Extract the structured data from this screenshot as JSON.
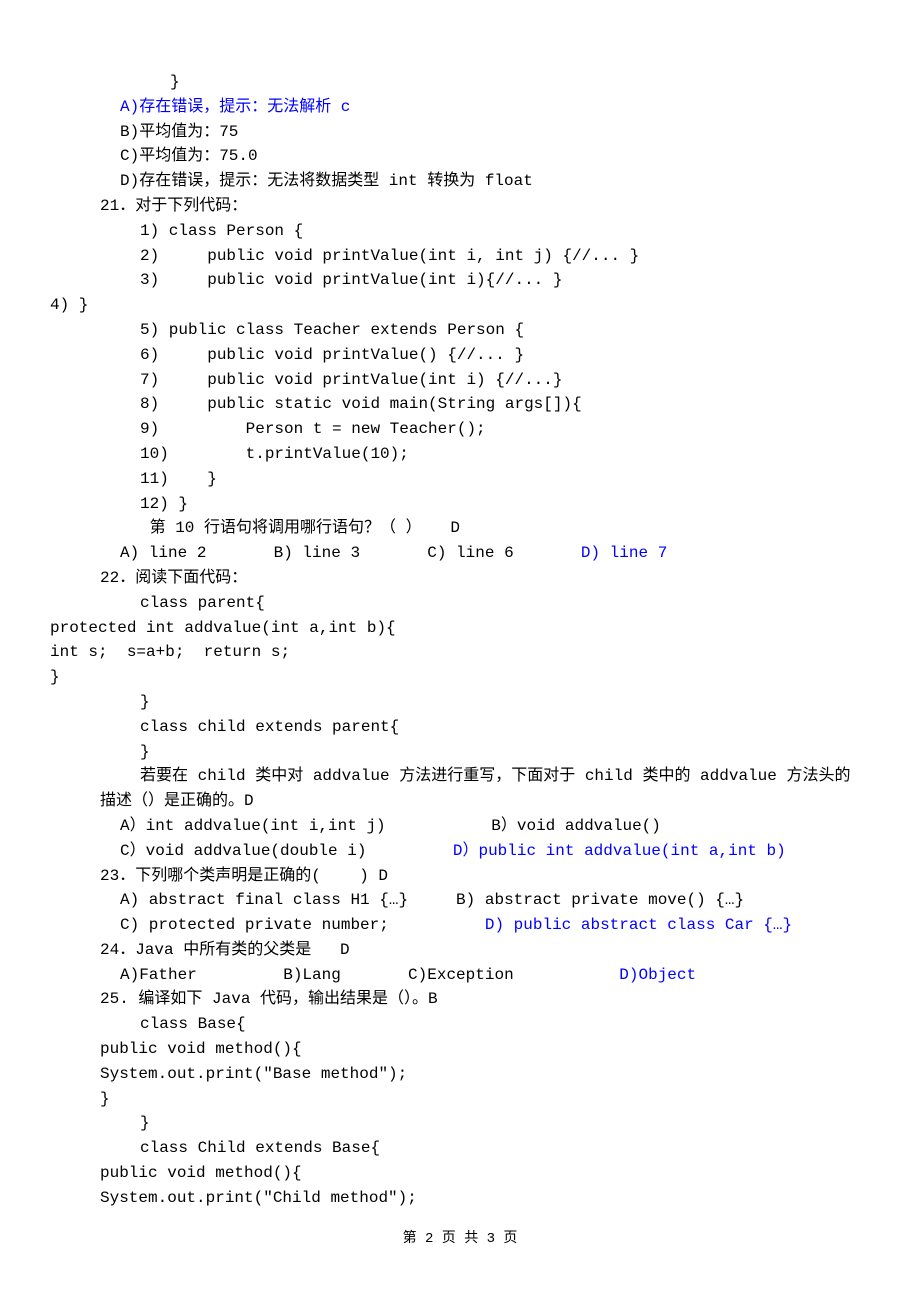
{
  "lines": [
    {
      "cls": "ind4",
      "text": "}"
    },
    {
      "cls": "ind2 blue",
      "text": "A)存在错误，提示：无法解析 c"
    },
    {
      "cls": "ind2",
      "text": "B)平均值为：75"
    },
    {
      "cls": "ind2",
      "text": "C)平均值为：75.0"
    },
    {
      "cls": "ind2",
      "text": "D)存在错误，提示：无法将数据类型 int 转换为 float"
    },
    {
      "cls": "ind1",
      "text": "21．对于下列代码："
    },
    {
      "cls": "ind3",
      "text": "1) class Person {"
    },
    {
      "cls": "ind3",
      "text": "2)     public void printValue(int i, int j) {//... }"
    },
    {
      "cls": "ind3",
      "text": "3)     public void printValue(int i){//... }"
    },
    {
      "cls": "no-ind",
      "text": "4) }"
    },
    {
      "cls": "ind3",
      "text": "5) public class Teacher extends Person {"
    },
    {
      "cls": "ind3",
      "text": "6)     public void printValue() {//... }"
    },
    {
      "cls": "ind3",
      "text": "7)     public void printValue(int i) {//...}"
    },
    {
      "cls": "ind3",
      "text": "8)     public static void main(String args[]){"
    },
    {
      "cls": "ind3",
      "text": "9)         Person t = new Teacher();"
    },
    {
      "cls": "ind3",
      "text": "10)        t.printValue(10);"
    },
    {
      "cls": "ind3",
      "text": "11)    }"
    },
    {
      "cls": "ind3",
      "text": "12) }"
    },
    {
      "cls": "ind3",
      "text": " 第 10 行语句将调用哪行语句？（ ）   D"
    },
    {
      "cls": "ind2",
      "parts": [
        {
          "text": "A) line 2       B) line 3       C) line 6       "
        },
        {
          "text": "D) line 7",
          "blue": true
        }
      ]
    },
    {
      "cls": "ind1",
      "text": "22．阅读下面代码："
    },
    {
      "cls": "ind3",
      "text": "class parent{"
    },
    {
      "cls": "no-ind",
      "text": "protected int addvalue(int a,int b){"
    },
    {
      "cls": "no-ind",
      "text": "int s;  s=a+b;  return s;"
    },
    {
      "cls": "no-ind",
      "text": "}"
    },
    {
      "cls": "ind3",
      "text": "}"
    },
    {
      "cls": "ind3",
      "text": "class child extends parent{"
    },
    {
      "cls": "ind3",
      "text": "}"
    },
    {
      "cls": "ind3",
      "text": "若要在 child 类中对 addvalue 方法进行重写，下面对于 child 类中的 addvalue 方法头的"
    },
    {
      "cls": "ind1",
      "text": "描述（）是正确的。D"
    },
    {
      "cls": "ind2",
      "text": "A）int addvalue(int i,int j)           B）void addvalue()"
    },
    {
      "cls": "ind2",
      "parts": [
        {
          "text": "C）void addvalue(double i)         "
        },
        {
          "text": "D）public int addvalue(int a,int b)",
          "blue": true
        }
      ]
    },
    {
      "cls": "ind1",
      "text": "23．下列哪个类声明是正确的(    ) D"
    },
    {
      "cls": "ind2",
      "text": "A) abstract final class H1 {…}     B) abstract private move() {…}"
    },
    {
      "cls": "ind2",
      "parts": [
        {
          "text": "C) protected private number;          "
        },
        {
          "text": "D) public abstract class Car {…}",
          "blue": true
        }
      ]
    },
    {
      "cls": "ind1",
      "text": "24．Java 中所有类的父类是   D"
    },
    {
      "cls": "ind2",
      "parts": [
        {
          "text": "A)Father         B)Lang       C)Exception           "
        },
        {
          "text": "D)Object",
          "blue": true
        }
      ]
    },
    {
      "cls": "ind1",
      "text": "25. 编译如下 Java 代码，输出结果是（）。B"
    },
    {
      "cls": "ind3",
      "text": "class Base{"
    },
    {
      "cls": "ind1",
      "text": "public void method(){"
    },
    {
      "cls": "ind1",
      "text": "System.out.print(\"Base method\");"
    },
    {
      "cls": "ind1",
      "text": "}"
    },
    {
      "cls": "ind3",
      "text": "}"
    },
    {
      "cls": "ind3",
      "text": "class Child extends Base{"
    },
    {
      "cls": "ind1",
      "text": "public void method(){"
    },
    {
      "cls": "ind1",
      "text": "System.out.print(\"Child method\");"
    }
  ],
  "footer": "第 2 页 共 3 页"
}
